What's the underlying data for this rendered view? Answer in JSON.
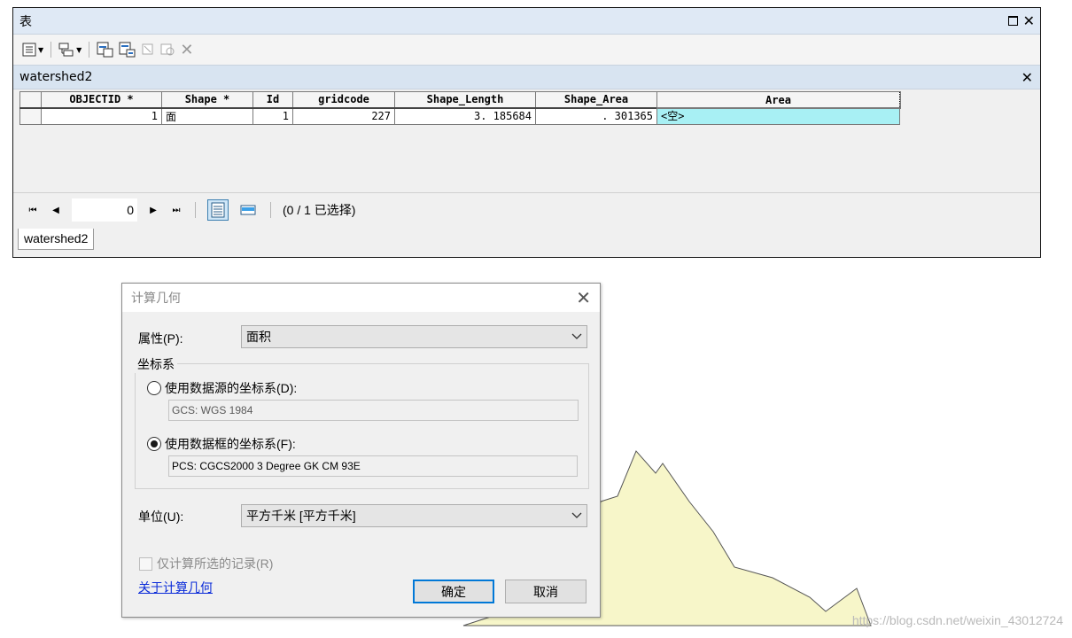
{
  "table_window": {
    "title": "表",
    "tab_title": "watershed2",
    "sheet_tab": "watershed2",
    "columns": [
      "OBJECTID *",
      "Shape *",
      "Id",
      "gridcode",
      "Shape_Length",
      "Shape_Area",
      "Area"
    ],
    "row": {
      "objectid": "1",
      "shape": "面",
      "id": "1",
      "gridcode": "227",
      "shape_length": "3. 185684",
      "shape_area": ". 301365",
      "area": "<空>"
    },
    "nav": {
      "record_value": "0",
      "selection_text": "(0 / 1 已选择)"
    }
  },
  "dialog": {
    "title": "计算几何",
    "property_label": "属性(P):",
    "property_value": "面积",
    "coord_group_label": "坐标系",
    "radio_source_label": "使用数据源的坐标系(D):",
    "source_cs": "GCS: WGS 1984",
    "radio_frame_label": "使用数据框的坐标系(F):",
    "frame_cs": "PCS: CGCS2000 3 Degree GK CM 93E",
    "unit_label": "单位(U):",
    "unit_value": "平方千米 [平方千米]",
    "only_selected_label": "仅计算所选的记录(R)",
    "about_link": "关于计算几何",
    "ok_button": "确定",
    "cancel_button": "取消"
  },
  "watermark": "https://blog.csdn.net/weixin_43012724",
  "colors": {
    "map_fill": "#f7f6c9",
    "area_cell": "#a8f0f4",
    "title_bar": "#dfe9f5",
    "link": "#0a2bd9"
  }
}
